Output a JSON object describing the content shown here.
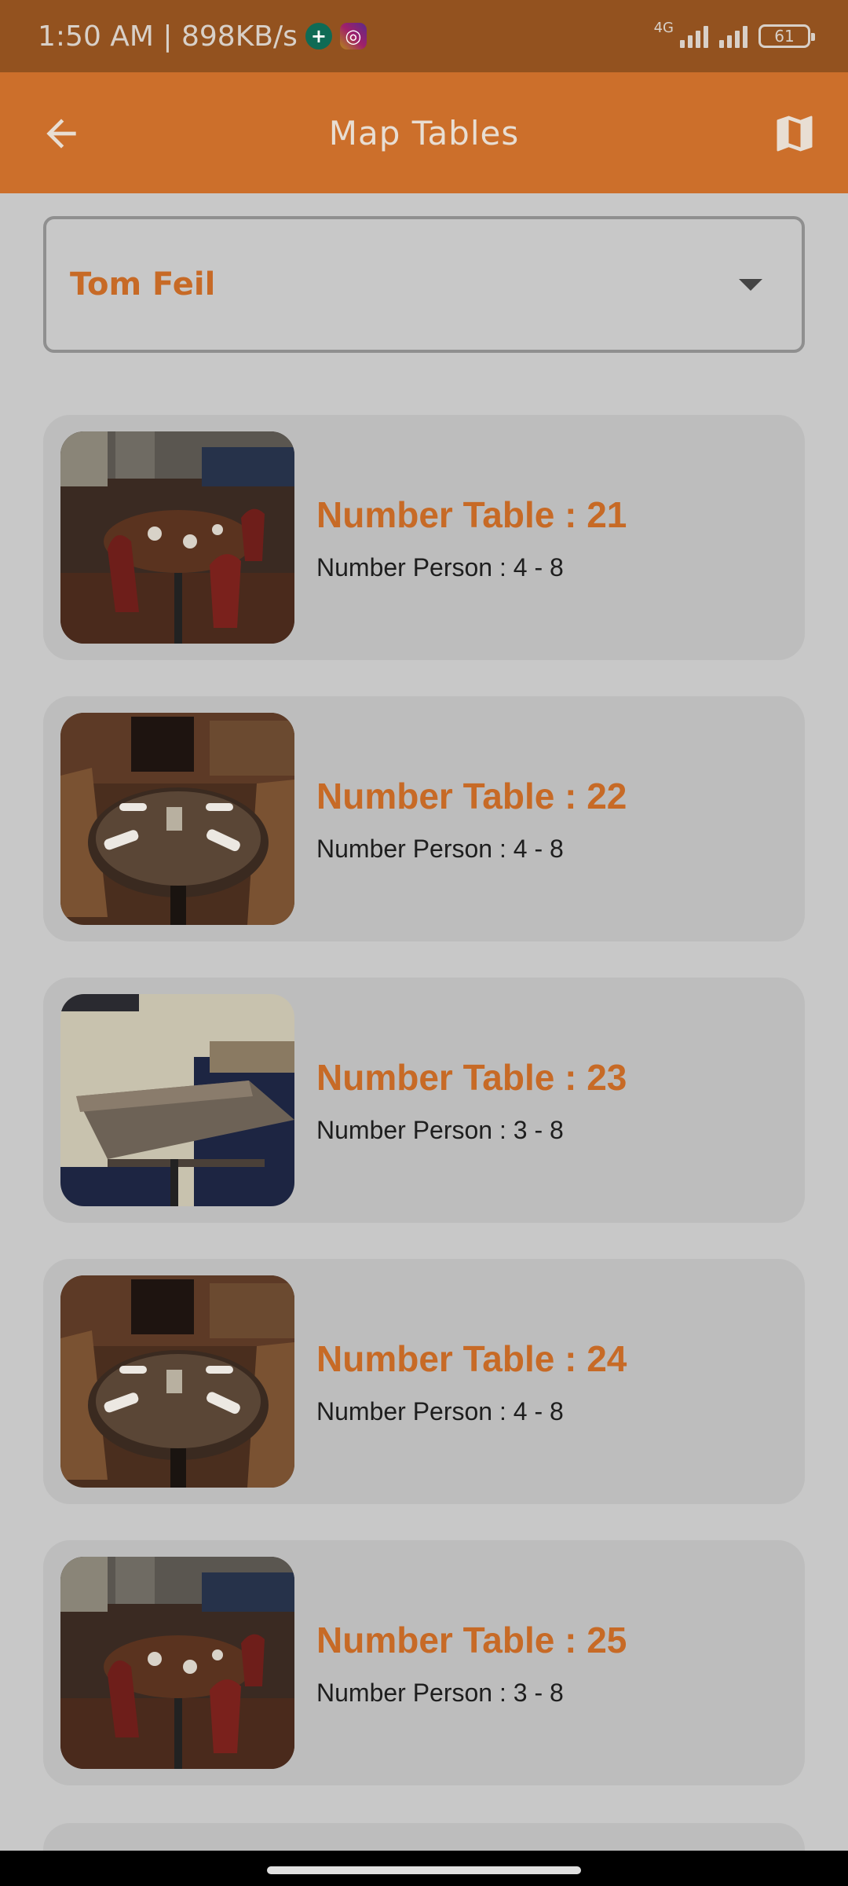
{
  "status_bar": {
    "time_speed": "1:50 AM | 898KB/s",
    "network": "4G",
    "battery": "61",
    "icons": [
      "green-plus-app-icon",
      "instagram-icon",
      "signal-icon",
      "signal-icon",
      "battery-icon"
    ]
  },
  "app_bar": {
    "title": "Map Tables",
    "back_icon": "arrow-left-icon",
    "map_icon": "map-icon"
  },
  "dropdown": {
    "selected": "Tom Feil"
  },
  "tables": [
    {
      "title": "Number Table : 21",
      "persons": "Number Person : 4 - 8",
      "image": "round-table-red-chairs"
    },
    {
      "title": "Number Table : 22",
      "persons": "Number Person : 4 - 8",
      "image": "round-table-napkins"
    },
    {
      "title": "Number Table : 23",
      "persons": "Number Person : 3 - 8",
      "image": "booth-table"
    },
    {
      "title": "Number Table : 24",
      "persons": "Number Person : 4 - 8",
      "image": "round-table-napkins"
    },
    {
      "title": "Number Table : 25",
      "persons": "Number Person : 3 - 8",
      "image": "round-table-red-chairs"
    }
  ],
  "colors": {
    "status_bar": "#93521f",
    "app_bar": "#cc6f2b",
    "accent": "#c76a26",
    "background": "#c8c8c8",
    "card": "#bdbdbd"
  }
}
